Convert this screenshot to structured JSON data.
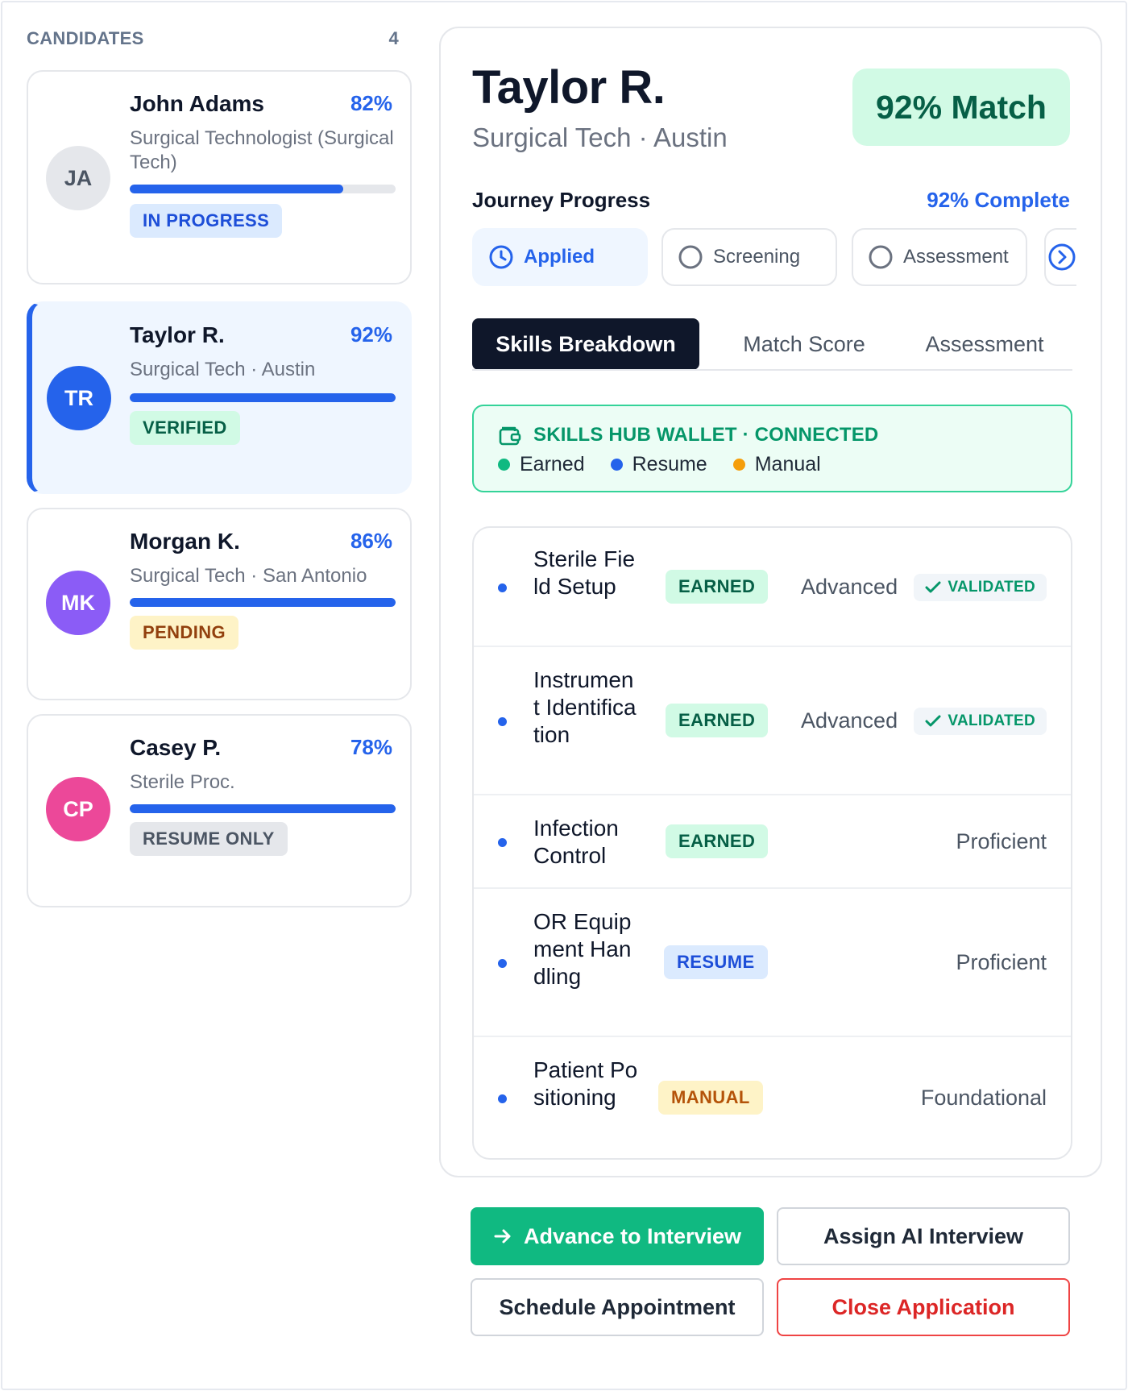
{
  "sidebar": {
    "title": "CANDIDATES",
    "count": "4",
    "candidates": [
      {
        "initials": "JA",
        "name": "John Adams",
        "match": "82%",
        "match_value": 82,
        "role": "Surgical Technologist (Surgical Tech)",
        "status": "IN PROGRESS"
      },
      {
        "initials": "TR",
        "name": "Taylor R.",
        "match": "92%",
        "match_value": 92,
        "role": "Surgical Tech · Austin",
        "status": "VERIFIED"
      },
      {
        "initials": "MK",
        "name": "Morgan K.",
        "match": "86%",
        "match_value": 86,
        "role": "Surgical Tech · San Antonio",
        "status": "PENDING"
      },
      {
        "initials": "CP",
        "name": "Casey P.",
        "match": "78%",
        "match_value": 78,
        "role": "Sterile Proc.",
        "status": "RESUME ONLY"
      }
    ]
  },
  "detail": {
    "name": "Taylor R.",
    "subtitle": "Surgical Tech · Austin",
    "match_label": "92% Match",
    "journey_title": "Journey Progress",
    "journey_complete": "92% Complete",
    "steps": [
      {
        "label": "Applied",
        "state": "active",
        "icon": "clock-icon"
      },
      {
        "label": "Screening",
        "state": "pending",
        "icon": "circle-icon"
      },
      {
        "label": "Assessment",
        "state": "pending",
        "icon": "circle-icon"
      }
    ],
    "tabs": [
      "Skills Breakdown",
      "Match Score",
      "Assessment"
    ],
    "active_tab": "Skills Breakdown",
    "wallet": {
      "title": "SKILLS HUB WALLET · CONNECTED",
      "legend": [
        {
          "label": "Earned",
          "color": "#10b981"
        },
        {
          "label": "Resume",
          "color": "#2563eb"
        },
        {
          "label": "Manual",
          "color": "#f59e0b"
        }
      ]
    },
    "skills": [
      {
        "name": "Sterile Field Setup",
        "source": "EARNED",
        "level": "Advanced",
        "validated": "VALIDATED"
      },
      {
        "name": "Instrument Identification",
        "source": "EARNED",
        "level": "Advanced",
        "validated": "VALIDATED"
      },
      {
        "name": "Infection Control",
        "source": "EARNED",
        "level": "Proficient",
        "validated": ""
      },
      {
        "name": "OR Equipment Handling",
        "source": "RESUME",
        "level": "Proficient",
        "validated": ""
      },
      {
        "name": "Patient Positioning",
        "source": "MANUAL",
        "level": "Foundational",
        "validated": ""
      }
    ]
  },
  "actions": {
    "advance": "Advance to Interview",
    "assign_ai": "Assign AI Interview",
    "schedule": "Schedule Appointment",
    "close": "Close Application"
  },
  "colors": {
    "accent": "#2563eb",
    "success": "#10b981",
    "danger": "#dc2626",
    "dark": "#0f172a"
  }
}
